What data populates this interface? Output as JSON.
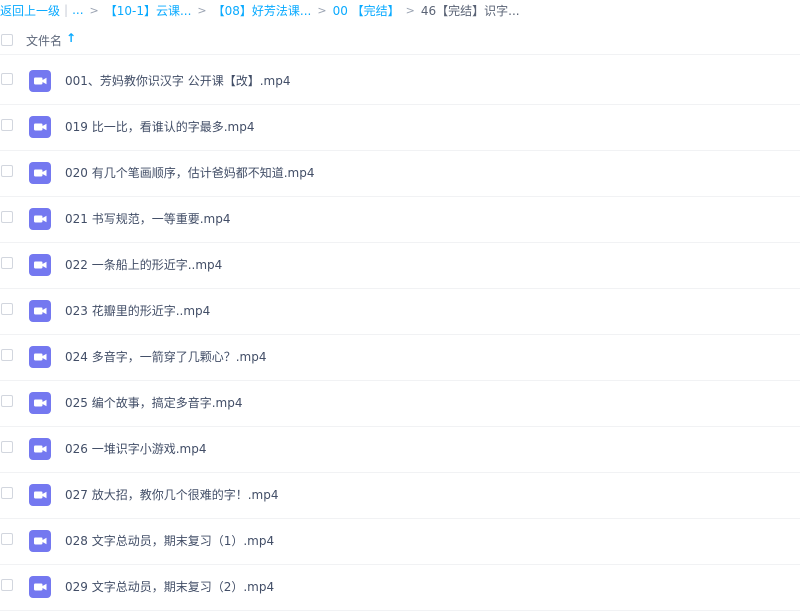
{
  "breadcrumb": {
    "back": "返回上一级",
    "ellipsis": "...",
    "items": [
      "【10-1】云课...",
      "【08】好芳法课...",
      "00 【完结】"
    ],
    "current": "46【完结】识字..."
  },
  "header": {
    "column_label": "文件名",
    "sort_icon": "arrow-up-icon",
    "sort_glyph": "↑"
  },
  "file_icon": "video-file-icon",
  "accent_color": "#09aaff",
  "file_icon_color": "#7478f0",
  "files": [
    "001、芳妈教你识汉字 公开课【改】.mp4",
    "019 比一比，看谁认的字最多.mp4",
    "020 有几个笔画顺序，估计爸妈都不知道.mp4",
    "021 书写规范，一等重要.mp4",
    "022 一条船上的形近字..mp4",
    "023 花瓣里的形近字..mp4",
    "024 多音字，一箭穿了几颗心？.mp4",
    "025 编个故事，搞定多音字.mp4",
    "026 一堆识字小游戏.mp4",
    "027 放大招，教你几个很难的字！.mp4",
    "028 文字总动员，期末复习（1）.mp4",
    "029 文字总动员，期末复习（2）.mp4"
  ]
}
